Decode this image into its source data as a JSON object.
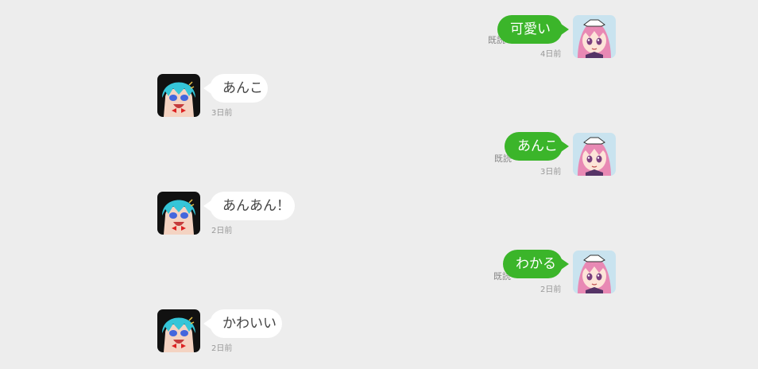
{
  "messages": [
    {
      "direction": "outgoing",
      "text": "可愛い",
      "time": "4日前",
      "read": "既読"
    },
    {
      "direction": "incoming",
      "text": "あんこ",
      "time": "3日前"
    },
    {
      "direction": "outgoing",
      "text": "あんこ",
      "time": "3日前",
      "read": "既読"
    },
    {
      "direction": "incoming",
      "text": "あんあん！",
      "time": "2日前"
    },
    {
      "direction": "outgoing",
      "text": "わかる",
      "time": "2日前",
      "read": "既読"
    },
    {
      "direction": "incoming",
      "text": "かわいい",
      "time": "2日前"
    }
  ],
  "colors": {
    "background": "#ededed",
    "outgoing_bubble": "#3bb52a",
    "incoming_bubble": "#ffffff",
    "timestamp": "#999999"
  }
}
